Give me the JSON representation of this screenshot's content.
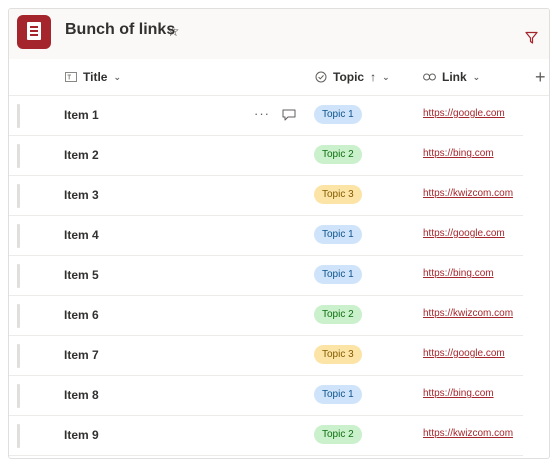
{
  "header": {
    "title": "Bunch of links",
    "star_icon": "star-outline-icon",
    "filter_icon": "filter-icon"
  },
  "columns": {
    "title": "Title",
    "topic": "Topic",
    "link": "Link",
    "add_icon": "plus-icon"
  },
  "row_actions": {
    "more": "···"
  },
  "topic_colors": {
    "Topic 1": {
      "bg": "#cfe4fa",
      "fg": "#0f548c"
    },
    "Topic 2": {
      "bg": "#caf0cc",
      "fg": "#0e700e"
    },
    "Topic 3": {
      "bg": "#fce4a6",
      "fg": "#835c00"
    }
  },
  "rows": [
    {
      "title": "Item 1",
      "topic": "Topic 1",
      "link": "https://google.com"
    },
    {
      "title": "Item 2",
      "topic": "Topic 2",
      "link": "https://bing.com"
    },
    {
      "title": "Item 3",
      "topic": "Topic 3",
      "link": "https://kwizcom.com"
    },
    {
      "title": "Item 4",
      "topic": "Topic 1",
      "link": "https://google.com"
    },
    {
      "title": "Item 5",
      "topic": "Topic 1",
      "link": "https://bing.com"
    },
    {
      "title": "Item 6",
      "topic": "Topic 2",
      "link": "https://kwizcom.com"
    },
    {
      "title": "Item 7",
      "topic": "Topic 3",
      "link": "https://google.com"
    },
    {
      "title": "Item 8",
      "topic": "Topic 1",
      "link": "https://bing.com"
    },
    {
      "title": "Item 9",
      "topic": "Topic 2",
      "link": "https://kwizcom.com"
    }
  ],
  "accent_color": "#a4262c"
}
